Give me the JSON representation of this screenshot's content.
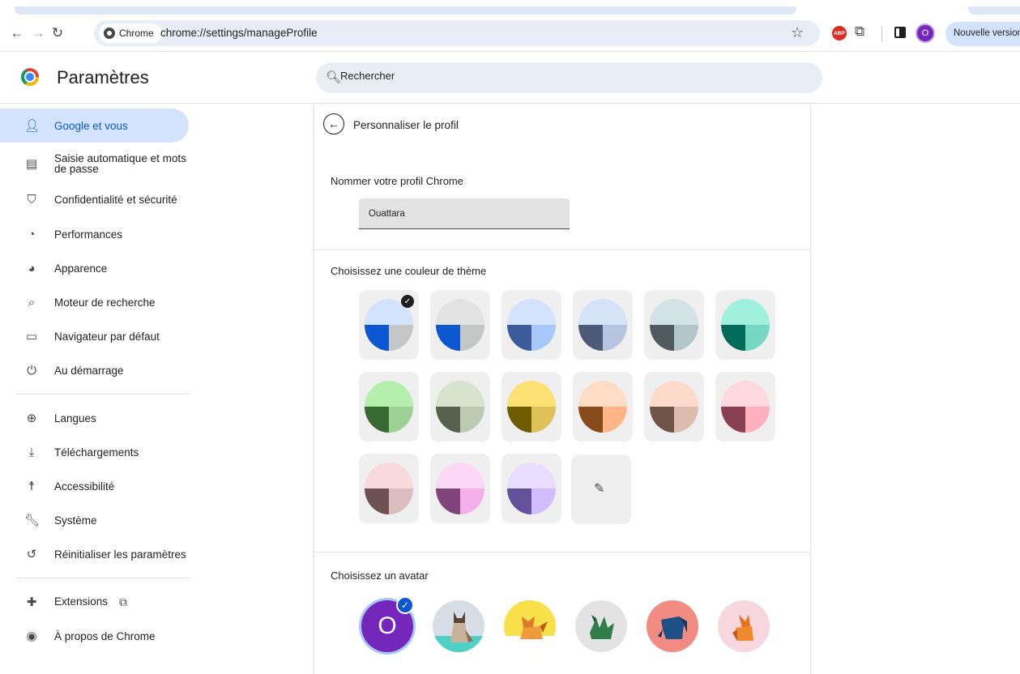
{
  "browser": {
    "chip_label": "Chrome",
    "url": "chrome://settings/manageProfile",
    "new_version_label": "Nouvelle version",
    "profile_initial": "O",
    "abp_label": "ABP"
  },
  "header": {
    "title": "Paramètres",
    "search_placeholder": "Rechercher"
  },
  "sidebar": {
    "items": [
      {
        "label": "Google et vous",
        "icon": "person-icon",
        "active": true
      },
      {
        "label": "Saisie automatique et mots de passe",
        "icon": "clipboard-icon"
      },
      {
        "label": "Confidentialité et sécurité",
        "icon": "shield-icon"
      },
      {
        "label": "Performances",
        "icon": "speedometer-icon"
      },
      {
        "label": "Apparence",
        "icon": "palette-icon"
      },
      {
        "label": "Moteur de recherche",
        "icon": "search-icon"
      },
      {
        "label": "Navigateur par défaut",
        "icon": "browser-window-icon"
      },
      {
        "label": "Au démarrage",
        "icon": "power-icon"
      },
      {
        "label": "Langues",
        "icon": "globe-icon"
      },
      {
        "label": "Téléchargements",
        "icon": "download-icon"
      },
      {
        "label": "Accessibilité",
        "icon": "accessibility-icon"
      },
      {
        "label": "Système",
        "icon": "wrench-icon"
      },
      {
        "label": "Réinitialiser les paramètres",
        "icon": "reset-icon"
      },
      {
        "label": "Extensions",
        "icon": "puzzle-icon"
      },
      {
        "label": "À propos de Chrome",
        "icon": "chrome-icon"
      }
    ]
  },
  "main": {
    "title": "Personnaliser le profil",
    "name_label": "Nommer votre profil Chrome",
    "name_value": "Ouattara",
    "theme_label": "Choisissez une couleur de thème",
    "avatar_label": "Choisissez un avatar",
    "selected_theme_index": 0,
    "themes": [
      {
        "top": "#d3e3fd",
        "left": "#0b57d0",
        "right": "#c4c7c5"
      },
      {
        "top": "#e3e3e3",
        "left": "#0b57d0",
        "right": "#c4c7c5"
      },
      {
        "top": "#d3e3fd",
        "left": "#3c5b9a",
        "right": "#a8c7fa"
      },
      {
        "top": "#d6e2f8",
        "left": "#4c5a78",
        "right": "#b6c4e0"
      },
      {
        "top": "#d3e2e4",
        "left": "#4f5b5f",
        "right": "#b3c6c9"
      },
      {
        "top": "#9ff0dd",
        "left": "#036b5a",
        "right": "#75d8c5"
      },
      {
        "top": "#b5efad",
        "left": "#376a30",
        "right": "#9dd195"
      },
      {
        "top": "#d7e2cf",
        "left": "#56614f",
        "right": "#bccab3"
      },
      {
        "top": "#fbe072",
        "left": "#6f5b00",
        "right": "#dec258"
      },
      {
        "top": "#ffdcc4",
        "left": "#8a4b1c",
        "right": "#ffb585"
      },
      {
        "top": "#fcdbcb",
        "left": "#6d5446",
        "right": "#dcbdad"
      },
      {
        "top": "#ffd8df",
        "left": "#8a3f52",
        "right": "#ffb0bf"
      },
      {
        "top": "#f8d9dc",
        "left": "#6c5052",
        "right": "#dbbdbf"
      },
      {
        "top": "#fbd8f4",
        "left": "#81447a",
        "right": "#f4aee8"
      },
      {
        "top": "#e9ddff",
        "left": "#65509b",
        "right": "#d0bcff"
      }
    ]
  }
}
